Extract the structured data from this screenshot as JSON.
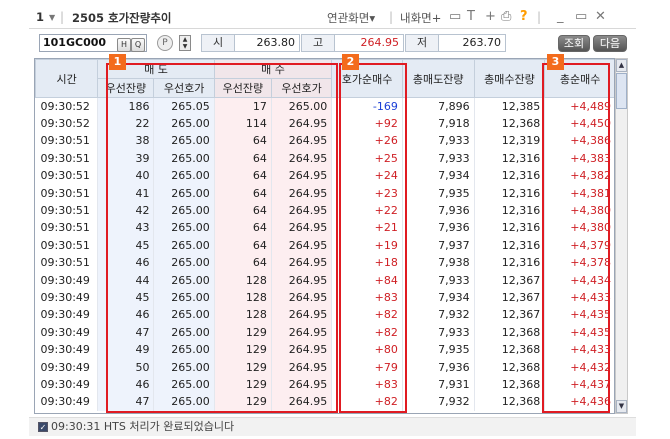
{
  "titlebar": {
    "screen_no": "1",
    "title": "2505 호가잔량추이",
    "menu_linked": "연관화면▾",
    "menu_mine": "내화면+",
    "help": "?"
  },
  "toolbar": {
    "code": "101GC000",
    "h_button": "H",
    "search_button": "Q",
    "p_button": "P",
    "open_label": "시",
    "open_value": "263.80",
    "high_label": "고",
    "high_value": "264.95",
    "low_label": "저",
    "low_value": "263.70",
    "query_button": "조회",
    "next_button": "다음"
  },
  "table": {
    "headers": {
      "time": "시간",
      "sell_group": "매 도",
      "buy_group": "매 수",
      "sell_qty": "우선잔량",
      "sell_price": "우선호가",
      "buy_qty": "우선잔량",
      "buy_price": "우선호가",
      "net_quote": "호가순매수",
      "total_sell": "총매도잔량",
      "total_buy": "총매수잔량",
      "total_net": "총순매수"
    },
    "rows": [
      [
        "09:30:52",
        "186",
        "265.05",
        "17",
        "265.00",
        "-169",
        "7,896",
        "12,385",
        "+4,489"
      ],
      [
        "09:30:52",
        "22",
        "265.00",
        "114",
        "264.95",
        "+92",
        "7,918",
        "12,368",
        "+4,450"
      ],
      [
        "09:30:51",
        "38",
        "265.00",
        "64",
        "264.95",
        "+26",
        "7,933",
        "12,319",
        "+4,386"
      ],
      [
        "09:30:51",
        "39",
        "265.00",
        "64",
        "264.95",
        "+25",
        "7,933",
        "12,316",
        "+4,383"
      ],
      [
        "09:30:51",
        "40",
        "265.00",
        "64",
        "264.95",
        "+24",
        "7,934",
        "12,316",
        "+4,382"
      ],
      [
        "09:30:51",
        "41",
        "265.00",
        "64",
        "264.95",
        "+23",
        "7,935",
        "12,316",
        "+4,381"
      ],
      [
        "09:30:51",
        "42",
        "265.00",
        "64",
        "264.95",
        "+22",
        "7,936",
        "12,316",
        "+4,380"
      ],
      [
        "09:30:51",
        "43",
        "265.00",
        "64",
        "264.95",
        "+21",
        "7,936",
        "12,316",
        "+4,380"
      ],
      [
        "09:30:51",
        "45",
        "265.00",
        "64",
        "264.95",
        "+19",
        "7,937",
        "12,316",
        "+4,379"
      ],
      [
        "09:30:51",
        "46",
        "265.00",
        "64",
        "264.95",
        "+18",
        "7,938",
        "12,316",
        "+4,378"
      ],
      [
        "09:30:49",
        "44",
        "265.00",
        "128",
        "264.95",
        "+84",
        "7,933",
        "12,367",
        "+4,434"
      ],
      [
        "09:30:49",
        "45",
        "265.00",
        "128",
        "264.95",
        "+83",
        "7,934",
        "12,367",
        "+4,433"
      ],
      [
        "09:30:49",
        "46",
        "265.00",
        "128",
        "264.95",
        "+82",
        "7,932",
        "12,367",
        "+4,435"
      ],
      [
        "09:30:49",
        "47",
        "265.00",
        "129",
        "264.95",
        "+82",
        "7,933",
        "12,368",
        "+4,435"
      ],
      [
        "09:30:49",
        "49",
        "265.00",
        "129",
        "264.95",
        "+80",
        "7,935",
        "12,368",
        "+4,433"
      ],
      [
        "09:30:49",
        "50",
        "265.00",
        "129",
        "264.95",
        "+79",
        "7,936",
        "12,368",
        "+4,432"
      ],
      [
        "09:30:49",
        "46",
        "265.00",
        "129",
        "264.95",
        "+83",
        "7,931",
        "12,368",
        "+4,437"
      ],
      [
        "09:30:49",
        "47",
        "265.00",
        "129",
        "264.95",
        "+82",
        "7,932",
        "12,368",
        "+4,436"
      ]
    ]
  },
  "badges": [
    "1",
    "2",
    "3"
  ],
  "status": {
    "text": "09:30:31  HTS 처리가 완료되었습니다"
  },
  "colors": {
    "highlight": "#e01b22",
    "badge": "#f36b1c",
    "negative": "#1b3fd6",
    "positive": "#cf1f24"
  }
}
